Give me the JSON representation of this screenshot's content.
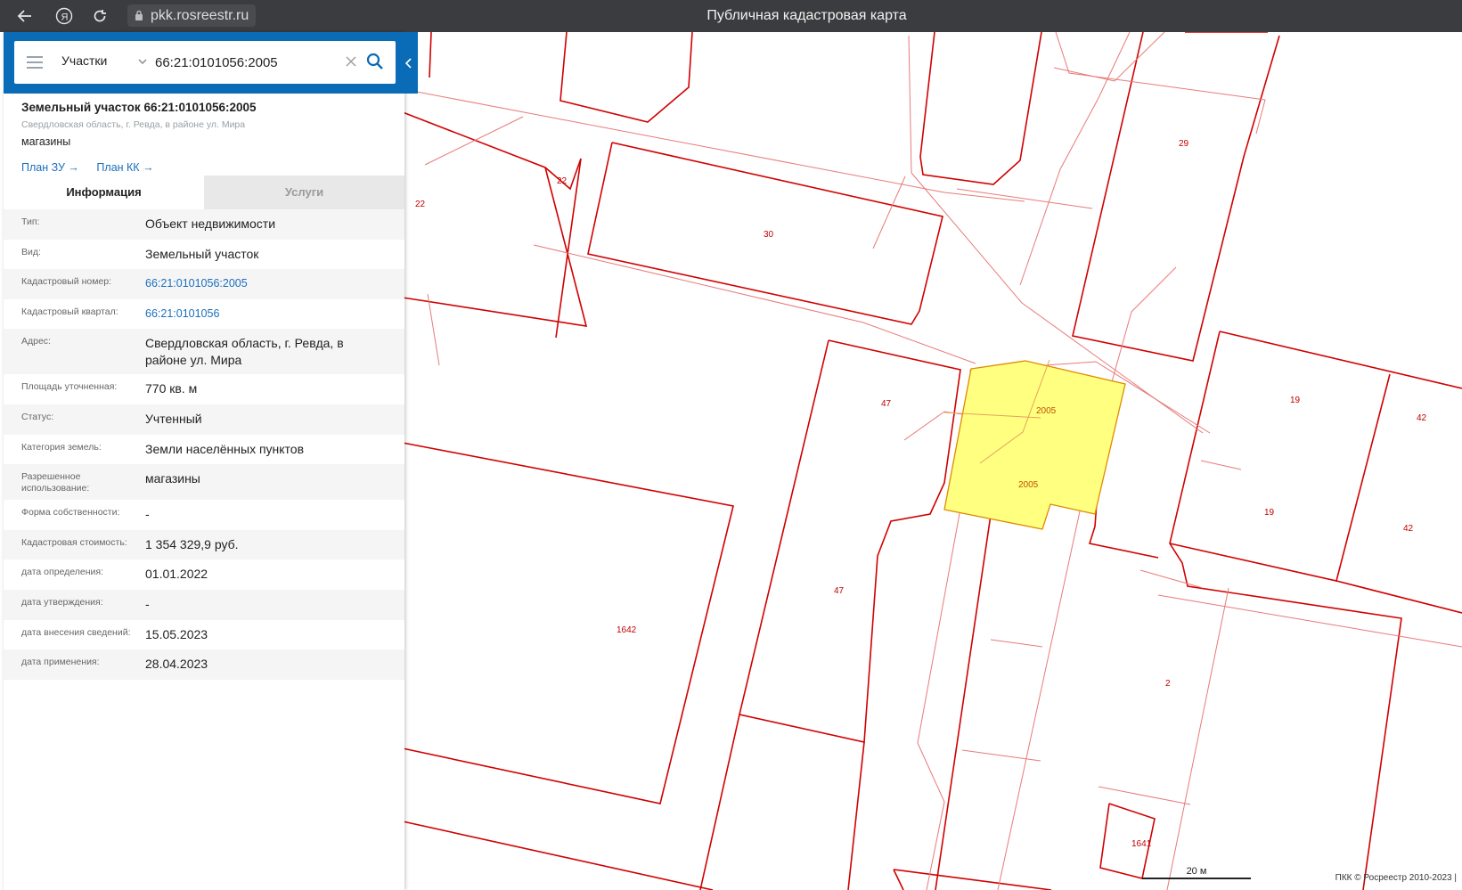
{
  "browser": {
    "url": "pkk.rosreestr.ru",
    "title": "Публичная кадастровая карта",
    "back_icon": "arrow-left-icon",
    "yandex_icon": "yandex-logo-icon",
    "reload_icon": "reload-icon",
    "lock_icon": "lock-icon"
  },
  "search": {
    "layer": "Участки",
    "query": "66:21:0101056:2005"
  },
  "object": {
    "title": "Земельный участок 66:21:0101056:2005",
    "address_short": "Свердловская область, г. Ревда, в районе ул. Мира",
    "use": "магазины",
    "links": [
      "План ЗУ →",
      "План КК →"
    ]
  },
  "tabs": [
    "Информация",
    "Услуги"
  ],
  "properties": [
    {
      "key": "Тип:",
      "value": "Объект недвижимости"
    },
    {
      "key": "Вид:",
      "value": "Земельный участок"
    },
    {
      "key": "Кадастровый номер:",
      "value": "66:21:0101056:2005",
      "link": true
    },
    {
      "key": "Кадастровый квартал:",
      "value": "66:21:0101056",
      "link": true
    },
    {
      "key": "Адрес:",
      "value": "Свердловская область, г. Ревда, в районе ул. Мира"
    },
    {
      "key": "Площадь уточненная:",
      "value": "770 кв. м"
    },
    {
      "key": "Статус:",
      "value": "Учтенный"
    },
    {
      "key": "Категория земель:",
      "value": "Земли населённых пунктов"
    },
    {
      "key": "Разрешенное использование:",
      "value": "магазины"
    },
    {
      "key": "Форма собственности:",
      "value": "-"
    },
    {
      "key": "Кадастровая стоимость:",
      "value": "1 354 329,9 руб."
    },
    {
      "key": "дата определения:",
      "value": "01.01.2022"
    },
    {
      "key": "дата утверждения:",
      "value": "-"
    },
    {
      "key": "дата внесения сведений:",
      "value": "15.05.2023"
    },
    {
      "key": "дата применения:",
      "value": "28.04.2023"
    }
  ],
  "map": {
    "parcel_labels": [
      "22",
      "22",
      "30",
      "29",
      "47",
      "47",
      "19",
      "19",
      "42",
      "42",
      "1642",
      "2",
      "1641"
    ],
    "selected_labels": [
      "2005",
      "2005"
    ],
    "scale": "20 м",
    "copyright": "ПКК © Росреестр 2010-2023 |",
    "colors": {
      "boundary": "#d00000",
      "selected_fill": "#ffff80",
      "selected_stroke": "#e08a00"
    }
  }
}
